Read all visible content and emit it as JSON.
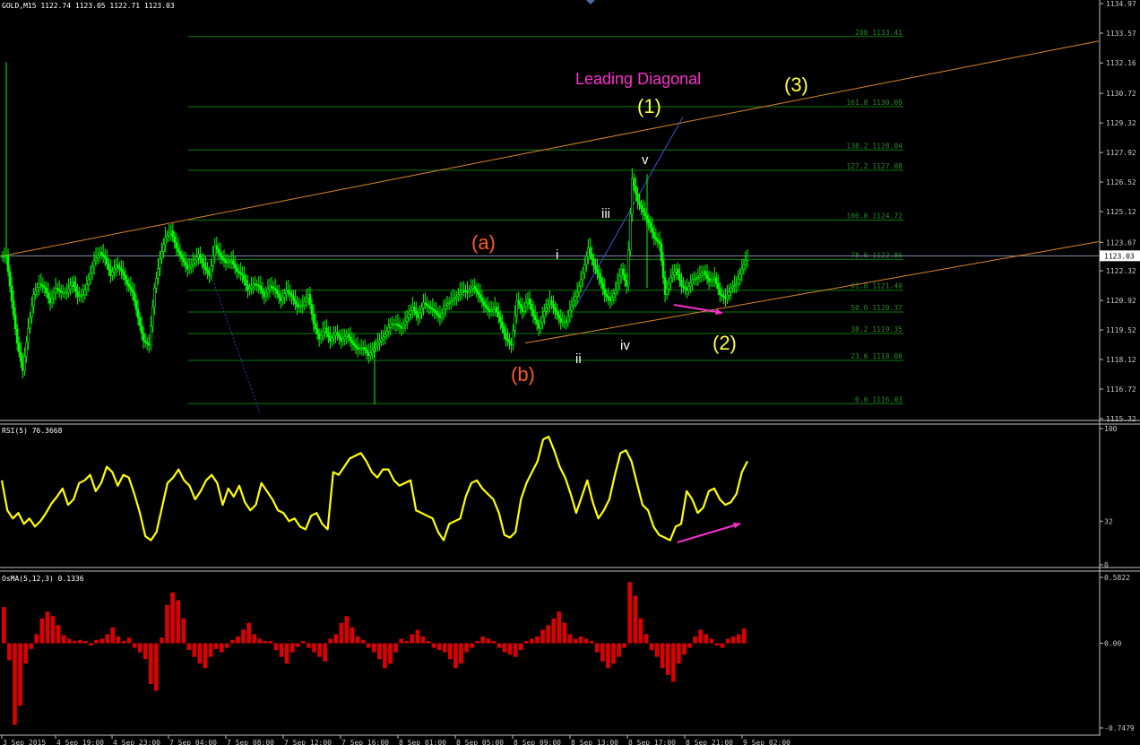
{
  "window": {
    "symbol_header": "GOLD,M15  1122.74 1123.05 1122.71 1123.03",
    "rsi_header": "RSI(5) 76.3668",
    "osma_header": "OsMA(5,12,3) 0.1336"
  },
  "colors": {
    "background": "#000000",
    "candles": "#00ff00",
    "fib_lines": "#0b7d0b",
    "channel": "#d9882a",
    "wave_line": "#3f53d8",
    "rsi": "#ffff00",
    "osma": "#dd0000",
    "magenta": "#ff2fcf",
    "orange_label": "#ff5a1f",
    "yellow_label": "#ffff3c",
    "white_label": "#ffffff"
  },
  "price_axis": {
    "ticks": [
      "1134.97",
      "1133.57",
      "1132.16",
      "1130.72",
      "1129.32",
      "1127.92",
      "1126.52",
      "1125.12",
      "1123.67",
      "1122.32",
      "1120.92",
      "1119.52",
      "1118.12",
      "1116.72",
      "1115.32"
    ],
    "current_price": "1123.03"
  },
  "rsi_axis": {
    "ticks": [
      "100",
      "32",
      "0"
    ]
  },
  "osma_axis": {
    "ticks": [
      "0.5822",
      "0.00",
      "-0.7479"
    ]
  },
  "time_axis": {
    "ticks": [
      "3 Sep 2015",
      "4 Sep 19:00",
      "4 Sep 23:00",
      "7 Sep 04:00",
      "7 Sep 08:00",
      "7 Sep 12:00",
      "7 Sep 16:00",
      "8 Sep 01:00",
      "8 Sep 05:00",
      "8 Sep 09:00",
      "8 Sep 13:00",
      "8 Sep 17:00",
      "8 Sep 21:00",
      "9 Sep 02:00"
    ]
  },
  "fib_levels": [
    {
      "label": "200  1133.41",
      "price": 1133.41
    },
    {
      "label": "161.8  1130.09",
      "price": 1130.09
    },
    {
      "label": "138.2  1128.04",
      "price": 1128.04
    },
    {
      "label": "127.2  1127.08",
      "price": 1127.08
    },
    {
      "label": "100.0  1124.72",
      "price": 1124.72
    },
    {
      "label": "78.6  1122.86",
      "price": 1122.86
    },
    {
      "label": "61.8  1121.40",
      "price": 1121.4
    },
    {
      "label": "50.0  1120.37",
      "price": 1120.37
    },
    {
      "label": "38.2  1119.35",
      "price": 1119.35
    },
    {
      "label": "23.6  1118.08",
      "price": 1118.08
    },
    {
      "label": "0.0  1116.03",
      "price": 1116.03
    }
  ],
  "annotations": {
    "leading_diagonal": "Leading Diagonal",
    "wave_1": "(1)",
    "wave_2": "(2)",
    "wave_3": "(3)",
    "wave_a": "(a)",
    "wave_b": "(b)",
    "sub_i": "i",
    "sub_ii": "ii",
    "sub_iii": "iii",
    "sub_iv": "iv",
    "sub_v": "v"
  },
  "chart_data": [
    {
      "type": "candlestick",
      "title": "GOLD,M15  1122.74 1123.05 1122.71 1123.03",
      "ylim": [
        1115.32,
        1134.97
      ],
      "close_path": [
        [
          "3 Sep 2015",
          1123.0
        ],
        [
          "",
          1120.9
        ],
        [
          "",
          1118.9
        ],
        [
          "",
          1117.6
        ],
        [
          "",
          1119.6
        ],
        [
          "",
          1121.2
        ],
        [
          "",
          1121.7
        ],
        [
          "",
          1121.5
        ],
        [
          "",
          1120.8
        ],
        [
          "",
          1121.5
        ],
        [
          "",
          1121.3
        ],
        [
          "4 Sep 19:00",
          1121.3
        ],
        [
          "",
          1121.8
        ],
        [
          "",
          1121.1
        ],
        [
          "",
          1121.2
        ],
        [
          "",
          1121.9
        ],
        [
          "",
          1122.8
        ],
        [
          "",
          1123.2
        ],
        [
          "",
          1122.9
        ],
        [
          "4 Sep 23:00",
          1122.1
        ],
        [
          "",
          1122.6
        ],
        [
          "",
          1122.3
        ],
        [
          "",
          1121.7
        ],
        [
          "",
          1121.3
        ],
        [
          "",
          1120.1
        ],
        [
          "",
          1119.0
        ],
        [
          "",
          1118.8
        ],
        [
          "",
          1121.5
        ],
        [
          "",
          1122.9
        ],
        [
          "7 Sep 04:00",
          1123.9
        ],
        [
          "",
          1124.2
        ],
        [
          "",
          1123.4
        ],
        [
          "",
          1122.9
        ],
        [
          "",
          1122.4
        ],
        [
          "",
          1122.7
        ],
        [
          "",
          1123.1
        ],
        [
          "",
          1122.5
        ],
        [
          "",
          1122.1
        ],
        [
          "",
          1123.5
        ],
        [
          "",
          1123.0
        ],
        [
          "7 Sep 08:00",
          1122.7
        ],
        [
          "",
          1122.8
        ],
        [
          "",
          1122.3
        ],
        [
          "",
          1122.1
        ],
        [
          "",
          1121.4
        ],
        [
          "",
          1121.7
        ],
        [
          "",
          1121.6
        ],
        [
          "",
          1121.1
        ],
        [
          "",
          1121.6
        ],
        [
          "7 Sep 12:00",
          1121.4
        ],
        [
          "",
          1120.9
        ],
        [
          "",
          1121.4
        ],
        [
          "",
          1121.1
        ],
        [
          "",
          1120.6
        ],
        [
          "",
          1120.7
        ],
        [
          "",
          1121.2
        ],
        [
          "",
          1119.8
        ],
        [
          "",
          1119.1
        ],
        [
          "",
          1119.6
        ],
        [
          "7 Sep 16:00",
          1119.0
        ],
        [
          "",
          1119.4
        ],
        [
          "",
          1119.0
        ],
        [
          "",
          1119.3
        ],
        [
          "",
          1118.9
        ],
        [
          "",
          1118.6
        ],
        [
          "",
          1118.7
        ],
        [
          "",
          1118.3
        ],
        [
          "",
          1118.7
        ],
        [
          "",
          1119.0
        ],
        [
          "",
          1119.3
        ],
        [
          "",
          1119.8
        ],
        [
          "8 Sep 01:00",
          1119.8
        ],
        [
          "",
          1119.6
        ],
        [
          "",
          1120.1
        ],
        [
          "",
          1120.6
        ],
        [
          "",
          1120.1
        ],
        [
          "",
          1120.8
        ],
        [
          "",
          1120.6
        ],
        [
          "",
          1120.4
        ],
        [
          "",
          1120.1
        ],
        [
          "",
          1120.7
        ],
        [
          "",
          1120.9
        ],
        [
          "8 Sep 05:00",
          1121.1
        ],
        [
          "",
          1121.4
        ],
        [
          "",
          1121.3
        ],
        [
          "",
          1121.6
        ],
        [
          "",
          1121.2
        ],
        [
          "",
          1120.7
        ],
        [
          "",
          1120.4
        ],
        [
          "",
          1120.6
        ],
        [
          "",
          1119.9
        ],
        [
          "",
          1119.1
        ],
        [
          "8 Sep 09:00",
          1118.8
        ],
        [
          "",
          1120.9
        ],
        [
          "",
          1120.4
        ],
        [
          "",
          1121.0
        ],
        [
          "",
          1120.2
        ],
        [
          "",
          1119.6
        ],
        [
          "",
          1120.4
        ],
        [
          "",
          1120.9
        ],
        [
          "",
          1120.4
        ],
        [
          "",
          1119.9
        ],
        [
          "8 Sep 13:00",
          1119.9
        ],
        [
          "",
          1120.7
        ],
        [
          "",
          1121.3
        ],
        [
          "",
          1122.2
        ],
        [
          "",
          1123.4
        ],
        [
          "",
          1122.6
        ],
        [
          "",
          1122.0
        ],
        [
          "",
          1121.2
        ],
        [
          "",
          1120.9
        ],
        [
          "",
          1121.4
        ],
        [
          "",
          1122.4
        ],
        [
          "",
          1121.6
        ],
        [
          "8 Sep 17:00",
          1126.7
        ],
        [
          "",
          1125.6
        ],
        [
          "",
          1125.1
        ],
        [
          "",
          1124.6
        ],
        [
          "",
          1123.9
        ],
        [
          "",
          1123.6
        ],
        [
          "",
          1121.2
        ],
        [
          "",
          1122.0
        ],
        [
          "",
          1122.4
        ],
        [
          "",
          1121.6
        ],
        [
          "",
          1121.4
        ],
        [
          "",
          1121.9
        ],
        [
          "8 Sep 21:00",
          1122.0
        ],
        [
          "",
          1122.3
        ],
        [
          "",
          1121.8
        ],
        [
          "",
          1122.0
        ],
        [
          "",
          1121.2
        ],
        [
          "",
          1121.0
        ],
        [
          "",
          1121.5
        ],
        [
          "",
          1121.7
        ],
        [
          "",
          1122.4
        ],
        [
          "9 Sep 02:00",
          1123.03
        ]
      ]
    },
    {
      "type": "line",
      "title": "RSI(5) 76.3668",
      "ylim": [
        0,
        100
      ],
      "series": [
        {
          "name": "RSI(5)",
          "values": [
            62,
            40,
            34,
            38,
            30,
            34,
            28,
            32,
            38,
            45,
            50,
            56,
            44,
            48,
            60,
            62,
            66,
            54,
            60,
            72,
            68,
            58,
            66,
            64,
            52,
            38,
            21,
            18,
            24,
            42,
            60,
            64,
            70,
            62,
            58,
            48,
            54,
            62,
            66,
            60,
            44,
            56,
            50,
            58,
            46,
            40,
            44,
            60,
            54,
            48,
            40,
            38,
            32,
            34,
            28,
            26,
            36,
            38,
            30,
            26,
            68,
            66,
            72,
            78,
            80,
            82,
            76,
            68,
            64,
            70,
            70,
            62,
            58,
            60,
            62,
            40,
            38,
            36,
            34,
            24,
            18,
            30,
            32,
            34,
            50,
            60,
            62,
            56,
            52,
            48,
            38,
            22,
            20,
            24,
            48,
            60,
            68,
            76,
            92,
            94,
            84,
            72,
            64,
            52,
            38,
            50,
            62,
            46,
            34,
            40,
            48,
            66,
            82,
            84,
            76,
            60,
            44,
            40,
            28,
            22,
            20,
            18,
            28,
            30,
            54,
            48,
            38,
            42,
            54,
            56,
            48,
            44,
            46,
            52,
            68,
            76
          ]
        }
      ]
    },
    {
      "type": "bar",
      "title": "OsMA(5,12,3) 0.1336",
      "ylim": [
        -0.7479,
        0.5822
      ],
      "series": [
        {
          "name": "OsMA",
          "values": [
            0.32,
            -0.15,
            -0.72,
            -0.55,
            -0.18,
            -0.05,
            0.08,
            0.22,
            0.28,
            0.24,
            0.16,
            0.07,
            0.04,
            0.02,
            0.03,
            0.02,
            -0.02,
            0.03,
            0.04,
            0.08,
            0.14,
            0.06,
            0.02,
            0.05,
            -0.04,
            -0.08,
            -0.14,
            -0.36,
            -0.42,
            0.05,
            0.34,
            0.45,
            0.38,
            0.22,
            -0.06,
            -0.12,
            -0.18,
            -0.22,
            -0.12,
            -0.05,
            -0.08,
            -0.04,
            0.03,
            0.06,
            0.12,
            0.18,
            0.08,
            0.04,
            0.02,
            0.02,
            -0.06,
            -0.12,
            -0.18,
            -0.08,
            -0.03,
            0.02,
            -0.04,
            -0.08,
            -0.12,
            -0.16,
            0.04,
            0.08,
            0.18,
            0.24,
            0.14,
            0.06,
            0.03,
            -0.04,
            -0.08,
            -0.14,
            -0.22,
            -0.18,
            -0.08,
            0.04,
            0.02,
            0.08,
            0.12,
            0.06,
            0.02,
            -0.04,
            -0.06,
            -0.08,
            -0.14,
            -0.22,
            -0.18,
            -0.08,
            -0.04,
            0.02,
            0.06,
            0.04,
            0.02,
            -0.04,
            -0.08,
            -0.1,
            -0.12,
            -0.06,
            0.02,
            0.04,
            0.06,
            0.12,
            0.16,
            0.22,
            0.28,
            0.18,
            0.08,
            0.04,
            0.06,
            0.04,
            0.02,
            -0.08,
            -0.16,
            -0.22,
            -0.18,
            -0.12,
            -0.04,
            0.54,
            0.42,
            0.22,
            0.08,
            -0.06,
            -0.12,
            -0.22,
            -0.28,
            -0.34,
            -0.18,
            -0.1,
            -0.04,
            0.06,
            0.12,
            0.08,
            0.04,
            -0.02,
            -0.04,
            0.04,
            0.06,
            0.08,
            0.13
          ]
        }
      ]
    }
  ]
}
